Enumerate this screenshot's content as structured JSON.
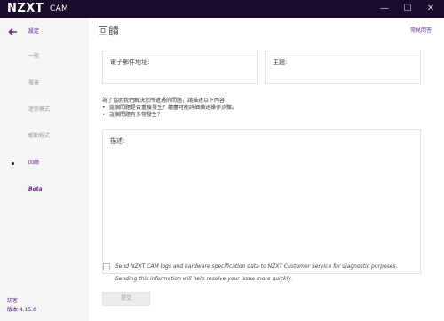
{
  "titlebar": {
    "logo": "NZXT",
    "logo_sub": "CAM",
    "minimize_glyph": "—",
    "maximize_glyph": "☐",
    "close_glyph": "✕"
  },
  "sidebar": {
    "back_label": "設定",
    "back_icon": "arrow-left-icon",
    "items": [
      {
        "label": "一般"
      },
      {
        "label": "覆蓋"
      },
      {
        "label": "迷你模式"
      },
      {
        "label": "驅動程式"
      },
      {
        "label": "回饋",
        "active": true
      },
      {
        "label": "Beta"
      }
    ],
    "footer_login": "訪客",
    "footer_version": "版本 4.15.0"
  },
  "main": {
    "title": "回饋",
    "faq_link": "常見問答",
    "email_label": "電子郵件地址:",
    "subject_label": "主題:",
    "help_intro": "為了協助我們解決您所遭遇的問題，請描述以下內容：",
    "help_bullets": [
      "這個問題是否重複發生？請盡可能詳細描述操作步驟。",
      "這個問題有多常發生？"
    ],
    "description_label": "描述:",
    "consent_line1": "Send NZXT CAM logs and hardware specification data to NZXT Customer Service for diagnostic purposes.",
    "consent_line2": "Sending this information will help resolve your issue more quickly.",
    "submit_label": "提交"
  },
  "colors": {
    "titlebar_bg": "#1b0b2c",
    "accent": "#6b2a9b",
    "sidebar_bg": "#f5f5f5"
  }
}
